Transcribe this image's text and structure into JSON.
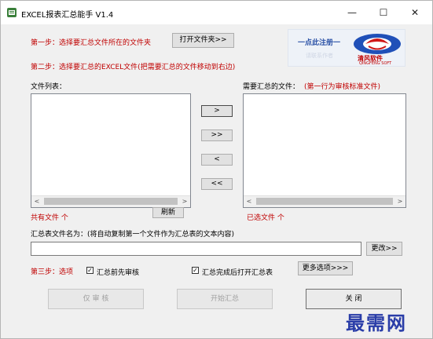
{
  "window": {
    "title": "EXCEL报表汇总能手 V1.4"
  },
  "controls": {
    "minimize": "—",
    "maximize": "☐",
    "close": "✕"
  },
  "step1": {
    "label": "第一步：选择要汇总文件所在的文件夹",
    "button": "打开文件夹>>"
  },
  "logo": {
    "register": "一点此注册一",
    "brand_cn": "清风软件",
    "brand_en": "QINGFENG SOFT",
    "faded": "请联系作者"
  },
  "step2": {
    "label": "第二步：选择要汇总的EXCEL文件(把需要汇总的文件移动到右边)"
  },
  "file_list": {
    "label": "文件列表：",
    "count_label": "共有文件 个",
    "refresh": "刷新"
  },
  "selected_list": {
    "label": "需要汇总的文件：",
    "note": "(第一行为审核标准文件)",
    "count_label": "已选文件 个"
  },
  "move_buttons": {
    "add": ">",
    "add_all": ">>",
    "remove": "<",
    "remove_all": "<<"
  },
  "scroll_arrows": {
    "left": "<",
    "right": ">"
  },
  "summary_name": {
    "label": "汇总表文件名为：(将自动复制第一个文件作为汇总表的文本内容)",
    "value": "",
    "change": "更改>>"
  },
  "step3": {
    "label": "第三步：选项",
    "option1": {
      "label": "汇总前先审核",
      "checked": true
    },
    "option2": {
      "label": "汇总完成后打开汇总表",
      "checked": true
    },
    "more": "更多选项>>>",
    "check_mark": "✓"
  },
  "actions": {
    "audit": "仅 审 核",
    "start": "开始汇总",
    "close": "关    闭"
  },
  "watermark": "最需网"
}
